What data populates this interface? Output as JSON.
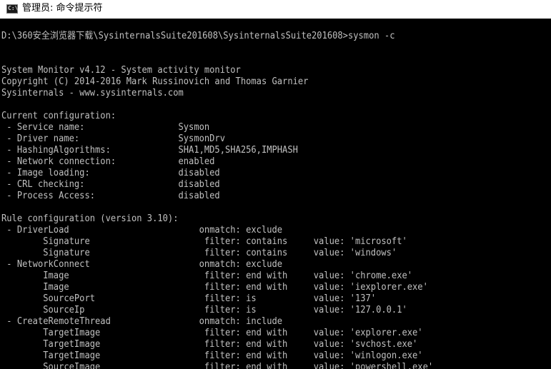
{
  "window": {
    "title": "管理员: 命令提示符",
    "icon": "cmd-icon"
  },
  "console": {
    "lines": [
      "D:\\360安全浏览器下载\\SysinternalsSuite201608\\SysinternalsSuite201608>sysmon -c",
      "",
      "",
      "System Monitor v4.12 - System activity monitor",
      "Copyright (C) 2014-2016 Mark Russinovich and Thomas Garnier",
      "Sysinternals - www.sysinternals.com",
      "",
      "Current configuration:",
      " - Service name:                  Sysmon",
      " - Driver name:                   SysmonDrv",
      " - HashingAlgorithms:             SHA1,MD5,SHA256,IMPHASH",
      " - Network connection:            enabled",
      " - Image loading:                 disabled",
      " - CRL checking:                  disabled",
      " - Process Access:                disabled",
      "",
      "Rule configuration (version 3.10):",
      " - DriverLoad                         onmatch: exclude",
      "        Signature                      filter: contains     value: 'microsoft'",
      "        Signature                      filter: contains     value: 'windows'",
      " - NetworkConnect                     onmatch: exclude",
      "        Image                          filter: end with     value: 'chrome.exe'",
      "        Image                          filter: end with     value: 'iexplorer.exe'",
      "        SourcePort                     filter: is           value: '137'",
      "        SourceIp                       filter: is           value: '127.0.0.1'",
      " - CreateRemoteThread                 onmatch: include",
      "        TargetImage                    filter: end with     value: 'explorer.exe'",
      "        TargetImage                    filter: end with     value: 'svchost.exe'",
      "        TargetImage                    filter: end with     value: 'winlogon.exe'",
      "        SourceImage                    filter: end with     value: 'powershell.exe'"
    ]
  },
  "colors": {
    "console_background": "#000000",
    "console_text": "#c0c0c0",
    "titlebar_background": "#ffffff"
  }
}
